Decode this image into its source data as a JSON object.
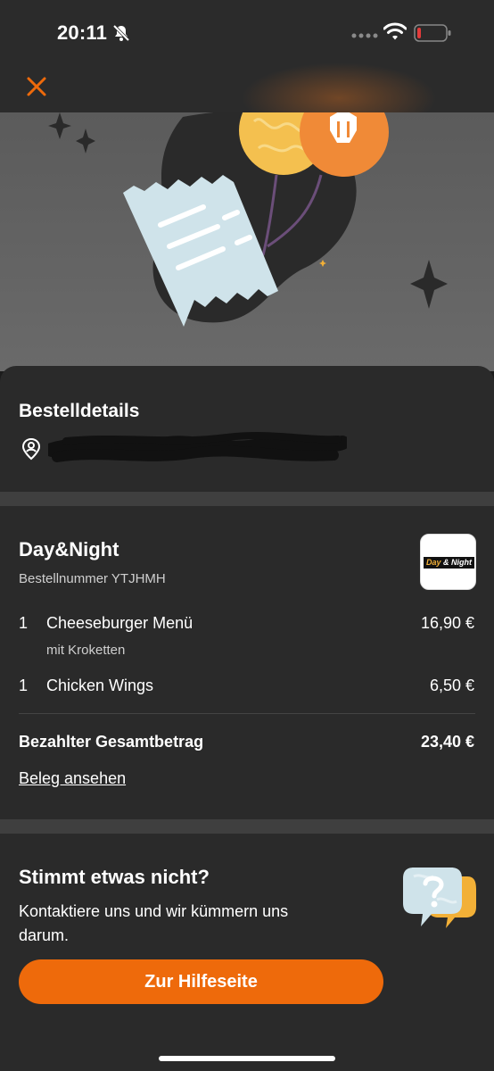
{
  "status_bar": {
    "time": "20:11"
  },
  "colors": {
    "accent": "#ee6a0b",
    "background": "#2a2a2a"
  },
  "header": {
    "close_icon": "close-icon"
  },
  "order_details": {
    "title": "Bestelldetails",
    "address_icon": "location-pin-icon"
  },
  "restaurant": {
    "name": "Day&Night",
    "order_number": "Bestellnummer YTJHMH",
    "logo_text_a": "Day ",
    "logo_text_b": "& Night"
  },
  "items": [
    {
      "qty": "1",
      "name": "Cheeseburger Menü",
      "option": "mit Kroketten",
      "price": "16,90 €"
    },
    {
      "qty": "1",
      "name": "Chicken Wings",
      "price": "6,50 €"
    }
  ],
  "total": {
    "label": "Bezahlter Gesamtbetrag",
    "value": "23,40 €"
  },
  "receipt_link": "Beleg ansehen",
  "help": {
    "title": "Stimmt etwas nicht?",
    "text": "Kontaktiere uns und wir kümmern uns darum.",
    "button": "Zur Hilfeseite"
  }
}
